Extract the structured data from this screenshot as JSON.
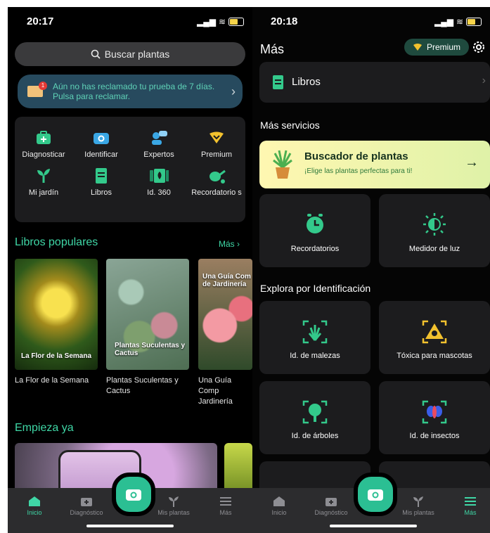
{
  "left": {
    "status": {
      "time": "20:17"
    },
    "search": {
      "placeholder": "Buscar plantas"
    },
    "banner": {
      "text": "Aún no has reclamado tu prueba de 7 días. Pulsa para reclamar.",
      "badge": "1"
    },
    "grid": [
      {
        "label": "Diagnosticar",
        "icon": "first-aid-kit-icon"
      },
      {
        "label": "Identificar",
        "icon": "camera-icon"
      },
      {
        "label": "Expertos",
        "icon": "expert-chat-icon"
      },
      {
        "label": "Premium",
        "icon": "premium-heart-icon"
      },
      {
        "label": "Mi jardín",
        "icon": "sprout-icon"
      },
      {
        "label": "Libros",
        "icon": "book-icon"
      },
      {
        "label": "Id. 360",
        "icon": "id360-icon"
      },
      {
        "label": "Recordatorio s",
        "icon": "watering-can-icon"
      }
    ],
    "popular": {
      "title": "Libros populares",
      "more": "Más ›"
    },
    "books": [
      {
        "cover_title": "La Flor de la Semana",
        "name": "La Flor de la Semana"
      },
      {
        "cover_title": "Plantas Suculentas y Cactus",
        "name": "Plantas Suculentas y Cactus"
      },
      {
        "cover_title": "Una Guía Com de Jardinería",
        "name": "Una Guía Comp Jardinería"
      }
    ],
    "start": {
      "title": "Empieza ya"
    },
    "tabs": [
      "Inicio",
      "Diagnóstico",
      "Mis plantas",
      "Más"
    ]
  },
  "right": {
    "status": {
      "time": "20:18"
    },
    "title": "Más",
    "premium": "Premium",
    "books_row": "Libros",
    "services_title": "Más servicios",
    "finder": {
      "title": "Buscador de plantas",
      "subtitle": "¡Elige las plantas perfectas para ti!"
    },
    "services": [
      {
        "label": "Recordatorios",
        "icon": "alarm-clock-icon"
      },
      {
        "label": "Medidor de luz",
        "icon": "light-meter-icon"
      }
    ],
    "explore_title": "Explora por Identificación",
    "explore": [
      {
        "label": "Id. de malezas",
        "icon": "weed-icon"
      },
      {
        "label": "Tóxica para mascotas",
        "icon": "toxic-icon"
      },
      {
        "label": "Id. de árboles",
        "icon": "tree-icon"
      },
      {
        "label": "Id. de insectos",
        "icon": "bug-icon"
      }
    ],
    "tabs": [
      "Inicio",
      "Diagnóstico",
      "Mis plantas",
      "Más"
    ]
  },
  "colors": {
    "accent": "#3fd7a6",
    "background": "#000000",
    "card": "#1c1c1e"
  }
}
